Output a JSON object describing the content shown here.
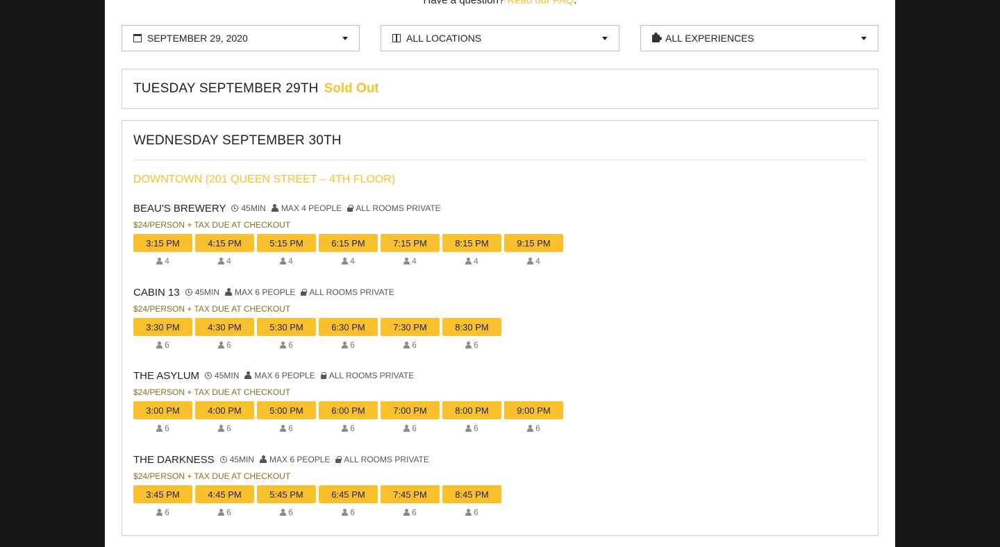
{
  "faq": {
    "prefix": "Have a question? ",
    "link": "Read our FAQ",
    "suffix": "."
  },
  "filters": {
    "date": {
      "label": "September 29, 2020",
      "icon": "calendar-icon"
    },
    "location": {
      "label": "All Locations",
      "icon": "columns-icon"
    },
    "experience": {
      "label": "All Experiences",
      "icon": "puzzle-icon"
    }
  },
  "days": [
    {
      "title": "Tuesday September 29th",
      "status": "Sold Out"
    },
    {
      "title": "Wednesday September 30th",
      "location": "Downtown (201 Queen Street – 4th Floor)",
      "rooms": [
        {
          "name": "Beau's Brewery",
          "duration": "45min",
          "max": "Max 4 people",
          "privacy": "All rooms private",
          "price": "$24/person + tax due at checkout",
          "slots": [
            {
              "time": "3:15 PM",
              "cap": "4"
            },
            {
              "time": "4:15 PM",
              "cap": "4"
            },
            {
              "time": "5:15 PM",
              "cap": "4"
            },
            {
              "time": "6:15 PM",
              "cap": "4"
            },
            {
              "time": "7:15 PM",
              "cap": "4"
            },
            {
              "time": "8:15 PM",
              "cap": "4"
            },
            {
              "time": "9:15 PM",
              "cap": "4"
            }
          ]
        },
        {
          "name": "Cabin 13",
          "duration": "45min",
          "max": "Max 6 people",
          "privacy": "All rooms private",
          "price": "$24/person + tax due at checkout",
          "slots": [
            {
              "time": "3:30 PM",
              "cap": "6"
            },
            {
              "time": "4:30 PM",
              "cap": "6"
            },
            {
              "time": "5:30 PM",
              "cap": "6"
            },
            {
              "time": "6:30 PM",
              "cap": "6"
            },
            {
              "time": "7:30 PM",
              "cap": "6"
            },
            {
              "time": "8:30 PM",
              "cap": "6"
            }
          ]
        },
        {
          "name": "The Asylum",
          "duration": "45min",
          "max": "Max 6 people",
          "privacy": "All rooms private",
          "price": "$24/person + tax due at checkout",
          "slots": [
            {
              "time": "3:00 PM",
              "cap": "6"
            },
            {
              "time": "4:00 PM",
              "cap": "6"
            },
            {
              "time": "5:00 PM",
              "cap": "6"
            },
            {
              "time": "6:00 PM",
              "cap": "6"
            },
            {
              "time": "7:00 PM",
              "cap": "6"
            },
            {
              "time": "8:00 PM",
              "cap": "6"
            },
            {
              "time": "9:00 PM",
              "cap": "6"
            }
          ]
        },
        {
          "name": "The Darkness",
          "duration": "45min",
          "max": "Max 6 people",
          "privacy": "All rooms private",
          "price": "$24/person + tax due at checkout",
          "slots": [
            {
              "time": "3:45 PM",
              "cap": "6"
            },
            {
              "time": "4:45 PM",
              "cap": "6"
            },
            {
              "time": "5:45 PM",
              "cap": "6"
            },
            {
              "time": "6:45 PM",
              "cap": "6"
            },
            {
              "time": "7:45 PM",
              "cap": "6"
            },
            {
              "time": "8:45 PM",
              "cap": "6"
            }
          ]
        }
      ]
    }
  ],
  "colors": {
    "accent": "#fbc02d",
    "background": "#161616",
    "panel": "#ffffff"
  }
}
